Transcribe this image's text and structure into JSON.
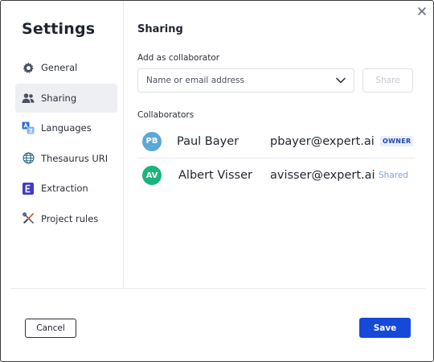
{
  "dialog": {
    "close_icon": "close-icon"
  },
  "sidebar": {
    "title": "Settings",
    "items": [
      {
        "label": "General",
        "icon": "gear-icon",
        "active": false
      },
      {
        "label": "Sharing",
        "icon": "users-icon",
        "active": true
      },
      {
        "label": "Languages",
        "icon": "translate-icon",
        "active": false
      },
      {
        "label": "Thesaurus URI",
        "icon": "globe-icon",
        "active": false
      },
      {
        "label": "Extraction",
        "icon": "extraction-icon",
        "active": false
      },
      {
        "label": "Project rules",
        "icon": "tools-icon",
        "active": false
      }
    ]
  },
  "main": {
    "section_title": "Sharing",
    "add_label": "Add as collaborator",
    "select_placeholder": "Name or email address",
    "share_label": "Share",
    "collaborators_label": "Collaborators",
    "collaborators": [
      {
        "initials": "PB",
        "name": "Paul Bayer",
        "email": "pbayer@expert.ai",
        "role": "OWNER",
        "avatar_color": "#5aa7d8"
      },
      {
        "initials": "AV",
        "name": "Albert Visser",
        "email": "avisser@expert.ai",
        "role": "Shared",
        "avatar_color": "#19b57c"
      }
    ]
  },
  "footer": {
    "cancel_label": "Cancel",
    "save_label": "Save"
  },
  "colors": {
    "accent": "#1749d8",
    "extraction_icon_bg": "#4338ca"
  }
}
